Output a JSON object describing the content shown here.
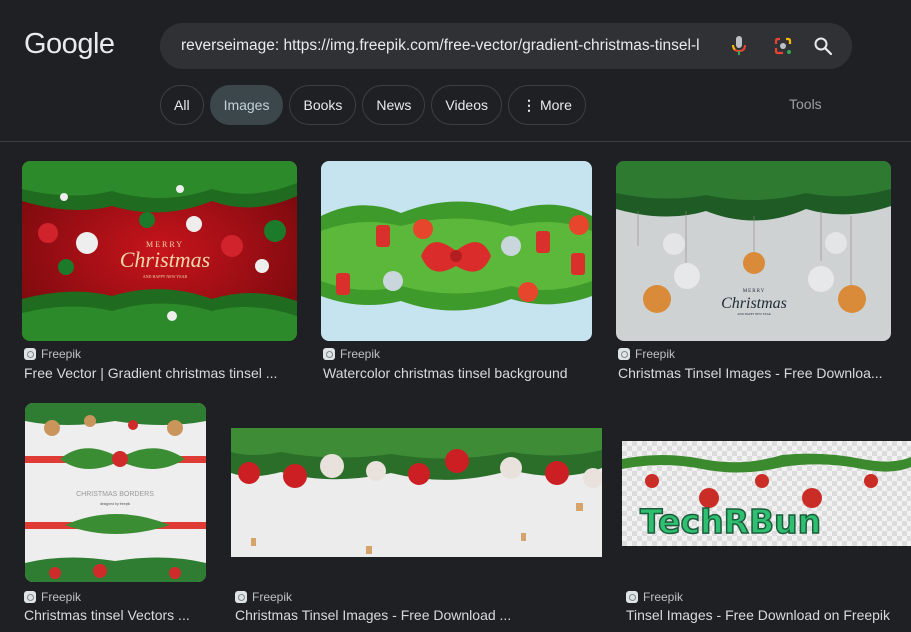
{
  "header": {
    "logo": "Google",
    "search": {
      "value": "reverseimage: https://img.freepik.com/free-vector/gradient-christmas-tinsel-l",
      "mic_icon": "mic-icon",
      "lens_icon": "camera-lens-icon",
      "search_icon": "search-icon"
    },
    "tabs": [
      {
        "label": "All",
        "active": false
      },
      {
        "label": "Images",
        "active": true
      },
      {
        "label": "Books",
        "active": false
      },
      {
        "label": "News",
        "active": false
      },
      {
        "label": "Videos",
        "active": false
      },
      {
        "label": "More",
        "active": false,
        "icon": "more-vert-icon"
      }
    ],
    "tools_label": "Tools"
  },
  "results": [
    {
      "source": "Freepik",
      "title": "Free Vector | Gradient christmas tinsel ...",
      "image_text": {
        "line1": "MERRY",
        "line2": "Christmas",
        "line3": "AND HAPPY NEW YEAR"
      }
    },
    {
      "source": "Freepik",
      "title": "Watercolor christmas tinsel background"
    },
    {
      "source": "Freepik",
      "title": "Christmas Tinsel Images - Free Downloa...",
      "image_text": {
        "line1": "MERRY",
        "line2": "Christmas",
        "line3": "AND HAPPY NEW YEAR"
      }
    },
    {
      "source": "Freepik",
      "title": "Christmas tinsel Vectors ...",
      "image_text": {
        "line1": "CHRISTMAS BORDERS",
        "line2": "designed by freepik"
      }
    },
    {
      "source": "Freepik",
      "title": "Christmas Tinsel Images - Free Download ..."
    },
    {
      "source": "Freepik",
      "title": "Tinsel Images - Free Download on Freepik",
      "image_text": {
        "watermark": "TechRBun"
      }
    }
  ],
  "colors": {
    "background": "#1f2023",
    "search_bg": "#303134",
    "active_tab_bg": "#3c474c",
    "text": "#e8eaed",
    "watermark": "#2ecc71"
  }
}
